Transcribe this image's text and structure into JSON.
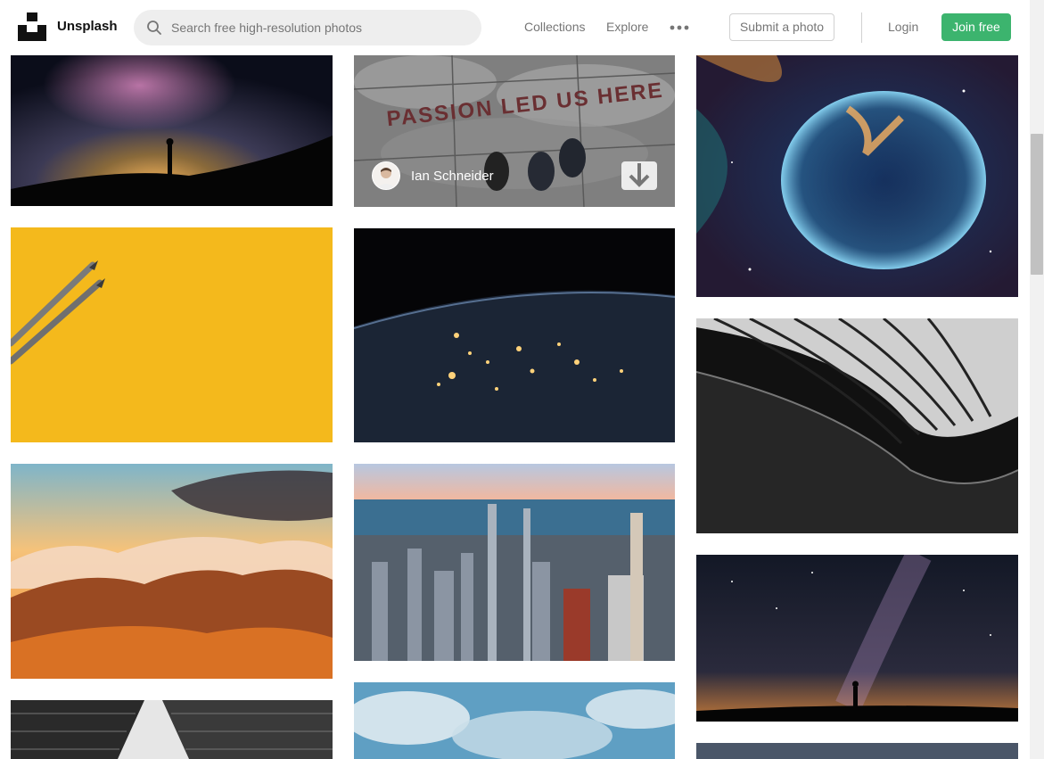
{
  "header": {
    "brand": "Unsplash",
    "search_placeholder": "Search free high-resolution photos",
    "nav": {
      "collections": "Collections",
      "explore": "Explore"
    },
    "submit_label": "Submit a photo",
    "login_label": "Login",
    "join_label": "Join free"
  },
  "photo_overlay": {
    "sign_text": "PASSION LED US HERE",
    "author_name": "Ian Schneider"
  },
  "colors": {
    "accent_green": "#3cb46e",
    "nav_gray": "#767676",
    "search_bg": "#eeeeee"
  },
  "icons": [
    "search-icon",
    "more-dots-icon",
    "download-icon",
    "unsplash-logo"
  ]
}
